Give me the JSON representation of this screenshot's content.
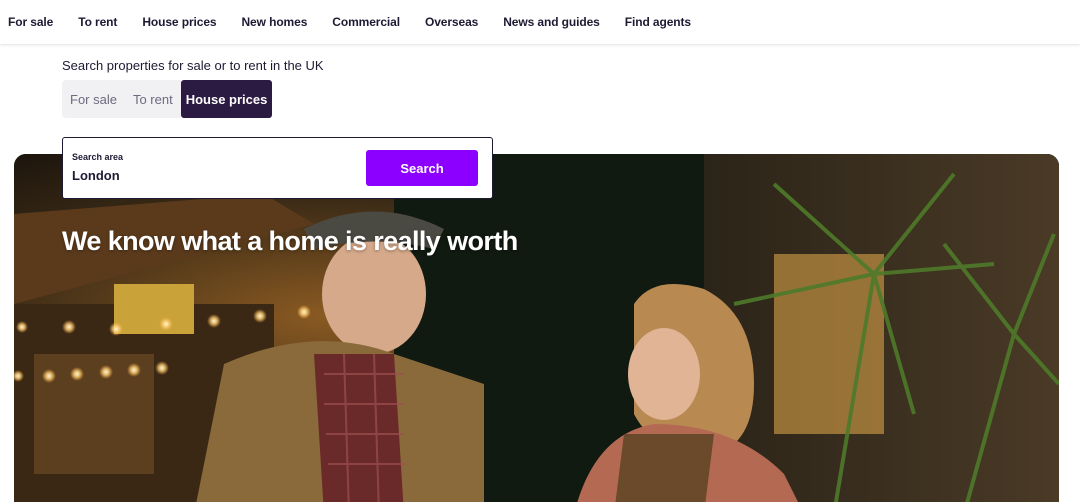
{
  "nav": {
    "items": [
      {
        "label": "For sale"
      },
      {
        "label": "To rent"
      },
      {
        "label": "House prices"
      },
      {
        "label": "New homes"
      },
      {
        "label": "Commercial"
      },
      {
        "label": "Overseas"
      },
      {
        "label": "News and guides"
      },
      {
        "label": "Find agents"
      }
    ]
  },
  "search": {
    "subtitle": "Search properties for sale or to rent in the UK",
    "tabs": [
      {
        "label": "For sale",
        "active": false
      },
      {
        "label": "To rent",
        "active": false
      },
      {
        "label": "House prices",
        "active": true
      }
    ],
    "field_label": "Search area",
    "value": "London",
    "button_label": "Search"
  },
  "hero": {
    "headline": "We know what a home is really worth"
  },
  "colors": {
    "accent": "#8b00ff",
    "active_tab": "#2b1a42",
    "text": "#1d1a33"
  }
}
